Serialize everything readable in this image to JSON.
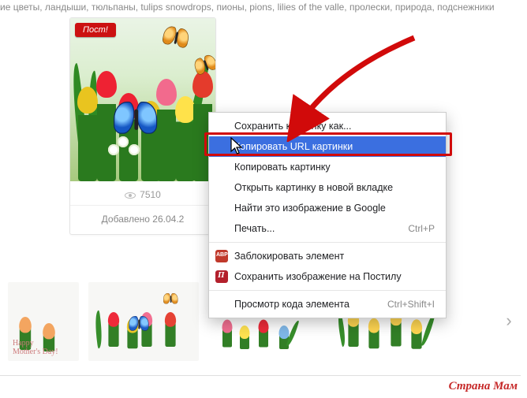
{
  "tags_line": "ие цветы, ландыши, тюльпаны, tulips snowdrops, пионы, pions, lilies of the valle, пролески, природа, подснежники",
  "card": {
    "badge": "Пост!",
    "views": "7510",
    "added": "Добавлено 26.04.2"
  },
  "context_menu": {
    "items": [
      {
        "label": "Сохранить картинку как..."
      },
      {
        "label": "Копировать URL картинки"
      },
      {
        "label": "Копировать картинку"
      },
      {
        "label": "Открыть картинку в новой вкладке"
      },
      {
        "label": "Найти это изображение в Google"
      },
      {
        "label": "Печать...",
        "shortcut": "Ctrl+P"
      },
      {
        "label": "Заблокировать элемент"
      },
      {
        "label": "Сохранить изображение на Постилу"
      },
      {
        "label": "Просмотр кода элемента",
        "shortcut": "Ctrl+Shift+I"
      }
    ]
  },
  "watermark": "Страна Мам"
}
